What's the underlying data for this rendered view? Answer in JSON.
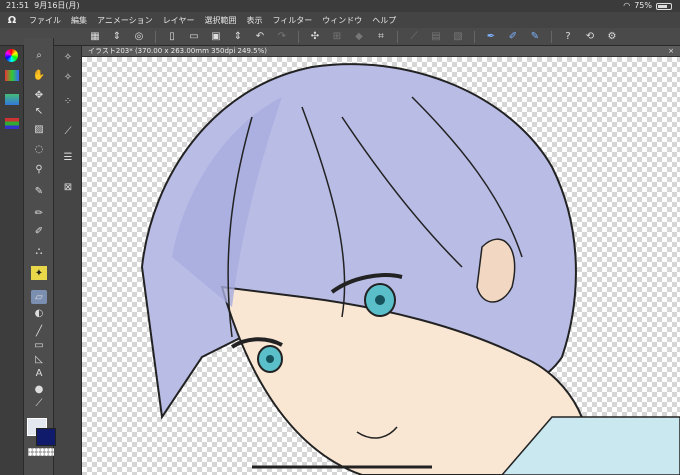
{
  "status": {
    "time": "21:51",
    "date": "9月16日(月)",
    "battery": "75%",
    "battery_level": 0.75
  },
  "menu": {
    "logo": "Ω",
    "items": [
      "ファイル",
      "編集",
      "アニメーション",
      "レイヤー",
      "選択範囲",
      "表示",
      "フィルター",
      "ウィンドウ",
      "ヘルプ"
    ]
  },
  "canvas_tab": {
    "title": "イラスト203* (370.00 x 263.00mm 350dpi 249.5%)",
    "close": "×"
  },
  "colors": {
    "main": "#e3e8f0",
    "sub": "#101c6b"
  },
  "icons": {
    "toolbar": [
      "grid-icon",
      "arrows-updown-icon",
      "spiral-icon",
      "new-file-icon",
      "open-folder-icon",
      "save-icon",
      "arrows-updown-icon",
      "undo-icon",
      "redo-icon",
      "sparkle-icon",
      "transform-icon",
      "fill-icon",
      "crop-icon",
      "ruler-icon",
      "ruler-icon",
      "ruler-icon",
      "pen-blue-icon",
      "pen-blue-icon",
      "pen-blue-icon",
      "help-icon",
      "rotate-icon",
      "settings-icon"
    ]
  }
}
